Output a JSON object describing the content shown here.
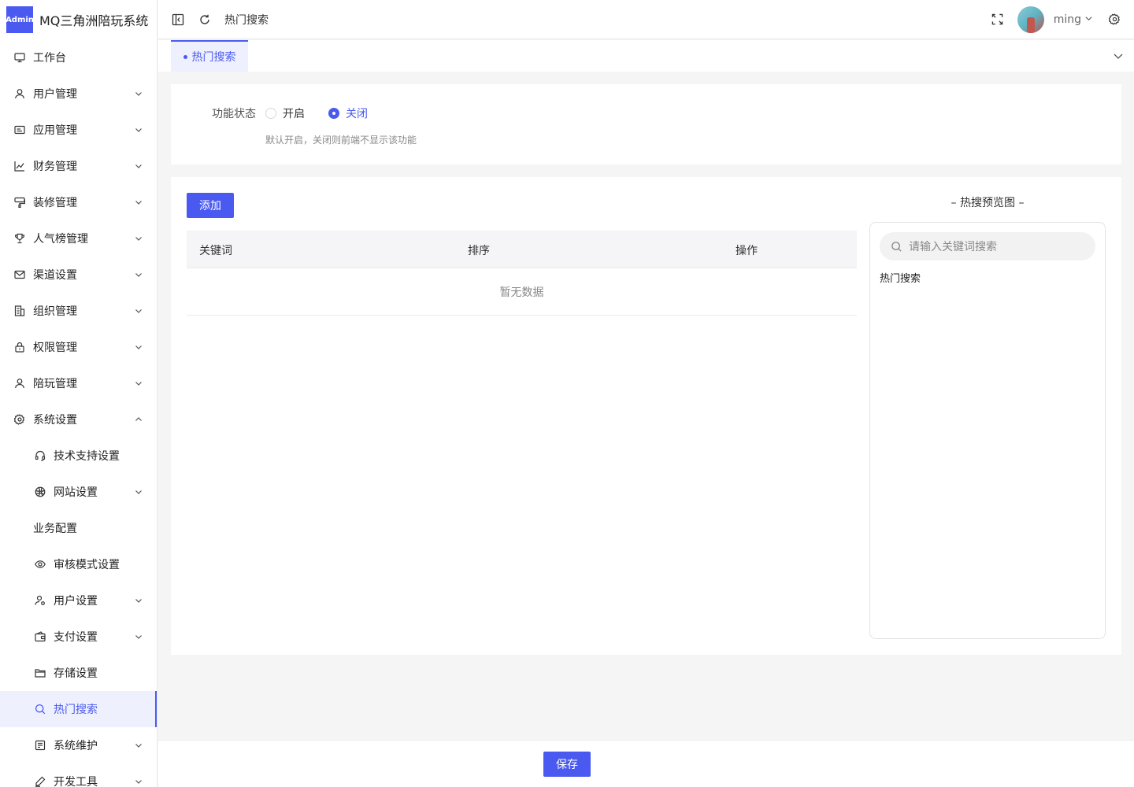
{
  "brand": {
    "logo_text": "Admin",
    "name": "MQ三角洲陪玩系统"
  },
  "header": {
    "breadcrumb": "热门搜索",
    "username": "ming"
  },
  "sidebar": {
    "items": [
      {
        "label": "工作台",
        "icon": "monitor-icon",
        "has_arrow": false
      },
      {
        "label": "用户管理",
        "icon": "user-icon",
        "has_arrow": true
      },
      {
        "label": "应用管理",
        "icon": "app-card-icon",
        "has_arrow": true
      },
      {
        "label": "财务管理",
        "icon": "chart-icon",
        "has_arrow": true
      },
      {
        "label": "装修管理",
        "icon": "brush-icon",
        "has_arrow": true
      },
      {
        "label": "人气榜管理",
        "icon": "trophy-icon",
        "has_arrow": true
      },
      {
        "label": "渠道设置",
        "icon": "mail-icon",
        "has_arrow": true
      },
      {
        "label": "组织管理",
        "icon": "building-icon",
        "has_arrow": true
      },
      {
        "label": "权限管理",
        "icon": "lock-icon",
        "has_arrow": true
      },
      {
        "label": "陪玩管理",
        "icon": "user-icon",
        "has_arrow": true
      },
      {
        "label": "系统设置",
        "icon": "gear-icon",
        "has_arrow": true,
        "expanded": true
      }
    ],
    "sub_items": [
      {
        "label": "技术支持设置",
        "icon": "headset-icon",
        "has_arrow": false
      },
      {
        "label": "网站设置",
        "icon": "globe-icon",
        "has_arrow": true
      },
      {
        "label": "业务配置",
        "icon": "",
        "has_arrow": false
      },
      {
        "label": "审核模式设置",
        "icon": "eye-icon",
        "has_arrow": false
      },
      {
        "label": "用户设置",
        "icon": "user-settings-icon",
        "has_arrow": true
      },
      {
        "label": "支付设置",
        "icon": "wallet-icon",
        "has_arrow": true
      },
      {
        "label": "存储设置",
        "icon": "folder-icon",
        "has_arrow": false
      },
      {
        "label": "热门搜索",
        "icon": "search-icon",
        "has_arrow": false,
        "active": true
      },
      {
        "label": "系统维护",
        "icon": "maintenance-icon",
        "has_arrow": true
      },
      {
        "label": "开发工具",
        "icon": "pen-icon",
        "has_arrow": true
      }
    ]
  },
  "tabs": [
    {
      "label": "热门搜索",
      "active": true
    }
  ],
  "function_status": {
    "label": "功能状态",
    "options": [
      {
        "label": "开启",
        "checked": false
      },
      {
        "label": "关闭",
        "checked": true
      }
    ],
    "help": "默认开启，关闭则前端不显示该功能"
  },
  "table": {
    "add_label": "添加",
    "columns": [
      "关键词",
      "排序",
      "操作"
    ],
    "empty_text": "暂无数据"
  },
  "preview": {
    "title": "– 热搜预览图 –",
    "search_placeholder": "请输入关键词搜索",
    "hot_label": "热门搜索"
  },
  "footer": {
    "save_label": "保存"
  },
  "colors": {
    "primary": "#4a5af0",
    "active_bg": "#eef0fd"
  }
}
